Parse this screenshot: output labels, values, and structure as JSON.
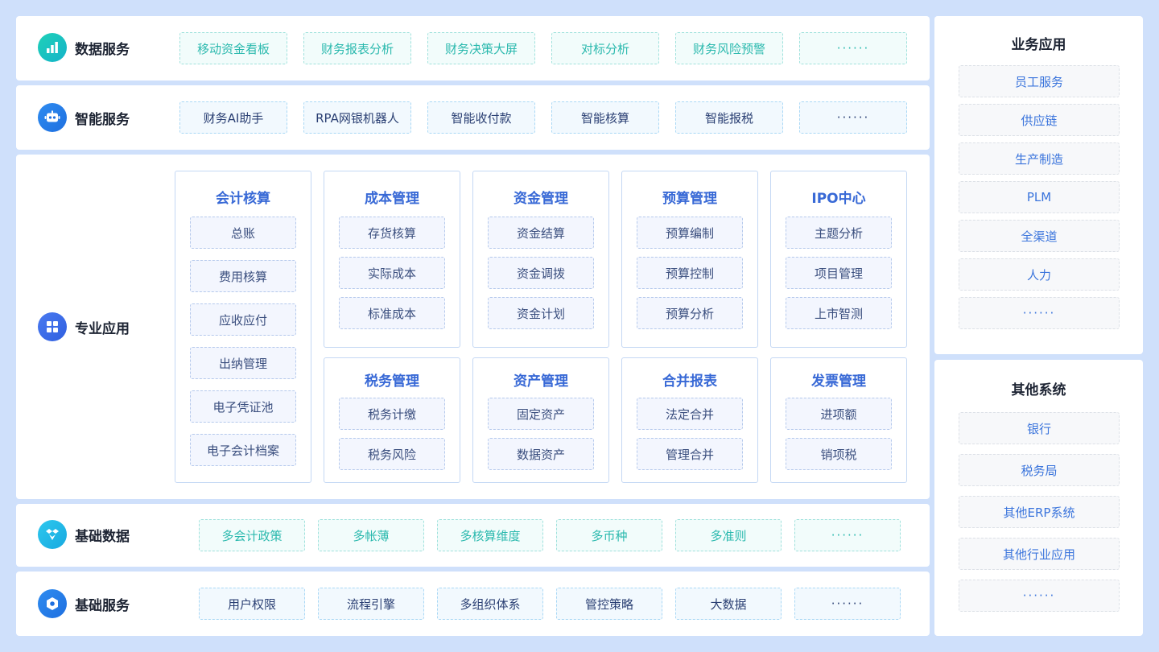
{
  "data_services": {
    "title": "数据服务",
    "icon": "bar-chart-icon",
    "items": [
      "移动资金看板",
      "财务报表分析",
      "财务决策大屏",
      "对标分析",
      "财务风险预警",
      "······"
    ]
  },
  "smart_services": {
    "title": "智能服务",
    "icon": "robot-icon",
    "items": [
      "财务AI助手",
      "RPA网银机器人",
      "智能收付款",
      "智能核算",
      "智能报税",
      "······"
    ]
  },
  "pro_apps": {
    "title": "专业应用",
    "icon": "grid-icon",
    "accounting": {
      "title": "会计核算",
      "items": [
        "总账",
        "费用核算",
        "应收应付",
        "出纳管理",
        "电子凭证池",
        "电子会计档案"
      ]
    },
    "modules": [
      {
        "title": "成本管理",
        "items": [
          "存货核算",
          "实际成本",
          "标准成本"
        ]
      },
      {
        "title": "资金管理",
        "items": [
          "资金结算",
          "资金调拨",
          "资金计划"
        ]
      },
      {
        "title": "预算管理",
        "items": [
          "预算编制",
          "预算控制",
          "预算分析"
        ]
      },
      {
        "title": "IPO中心",
        "items": [
          "主题分析",
          "项目管理",
          "上市智测"
        ]
      },
      {
        "title": "税务管理",
        "items": [
          "税务计缴",
          "税务风险"
        ]
      },
      {
        "title": "资产管理",
        "items": [
          "固定资产",
          "数据资产"
        ]
      },
      {
        "title": "合并报表",
        "items": [
          "法定合并",
          "管理合并"
        ]
      },
      {
        "title": "发票管理",
        "items": [
          "进项额",
          "销项税"
        ]
      }
    ]
  },
  "base_data": {
    "title": "基础数据",
    "icon": "layers-icon",
    "items": [
      "多会计政策",
      "多帐薄",
      "多核算维度",
      "多币种",
      "多准则",
      "······"
    ]
  },
  "base_services": {
    "title": "基础服务",
    "icon": "gear-icon",
    "items": [
      "用户权限",
      "流程引擎",
      "多组织体系",
      "管控策略",
      "大数据",
      "······"
    ]
  },
  "business_apps": {
    "title": "业务应用",
    "items": [
      "员工服务",
      "供应链",
      "生产制造",
      "PLM",
      "全渠道",
      "人力",
      "······"
    ]
  },
  "other_systems": {
    "title": "其他系统",
    "items": [
      "银行",
      "税务局",
      "其他ERP系统",
      "其他行业应用",
      "······"
    ]
  },
  "colors": {
    "background": "#cfe0fb",
    "teal_chip_text": "#2bb9ae",
    "module_title": "#3869d6",
    "side_item_text": "#3a74dc"
  }
}
